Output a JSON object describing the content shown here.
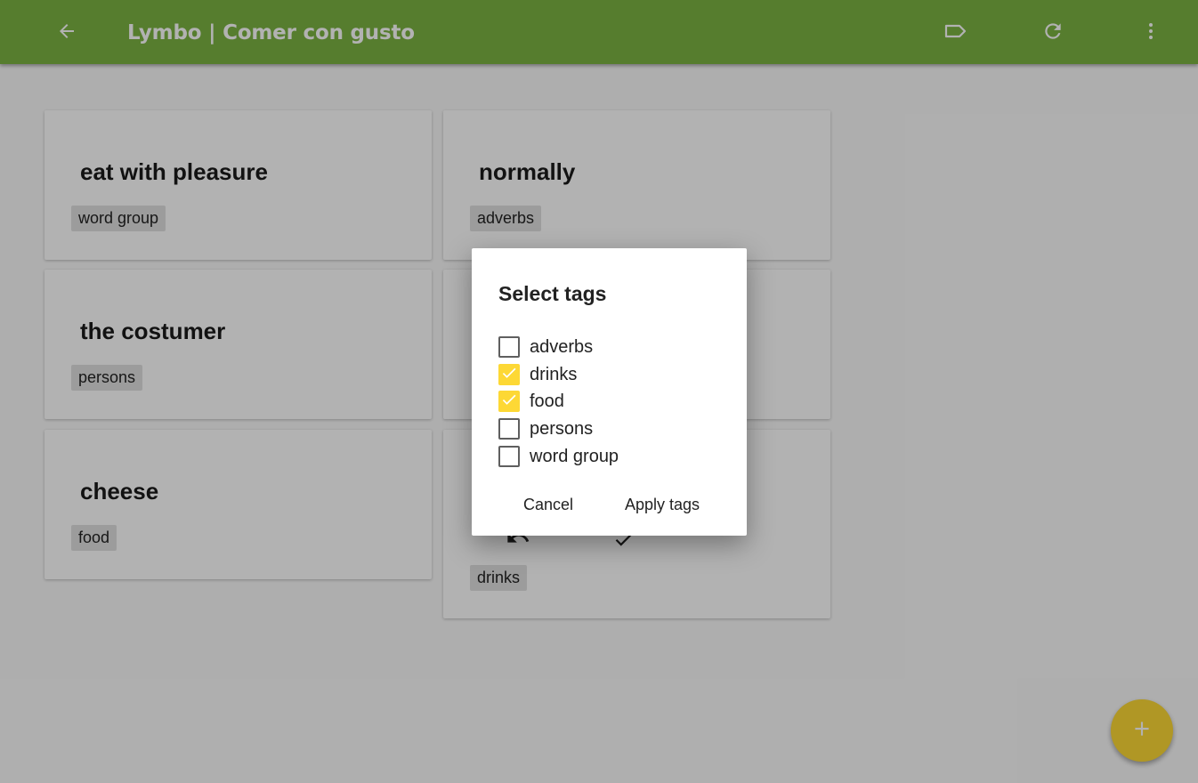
{
  "appbar": {
    "title": "Lymbo | Comer con gusto",
    "icons": [
      "back-arrow-icon",
      "tag-icon",
      "refresh-icon",
      "more-vert-icon"
    ],
    "color": "#7cb342"
  },
  "cards": [
    {
      "word": "eat with pleasure",
      "tag": "word group"
    },
    {
      "word": "normally",
      "tag": "adverbs"
    },
    {
      "word": "the costumer",
      "tag": "persons"
    },
    {
      "word": "",
      "tag": ""
    },
    {
      "word": "cheese",
      "tag": "food"
    },
    {
      "word": "",
      "tag": "drinks"
    }
  ],
  "dialog": {
    "title": "Select tags",
    "options": [
      {
        "label": "adverbs",
        "checked": false
      },
      {
        "label": "drinks",
        "checked": true
      },
      {
        "label": "food",
        "checked": true
      },
      {
        "label": "persons",
        "checked": false
      },
      {
        "label": "word group",
        "checked": false
      }
    ],
    "cancel_label": "Cancel",
    "apply_label": "Apply tags"
  },
  "fab": {
    "icon": "plus-icon",
    "color": "#fdd835"
  },
  "colors": {
    "accent": "#fdd835",
    "checkbox_checked": "#fdd835"
  }
}
